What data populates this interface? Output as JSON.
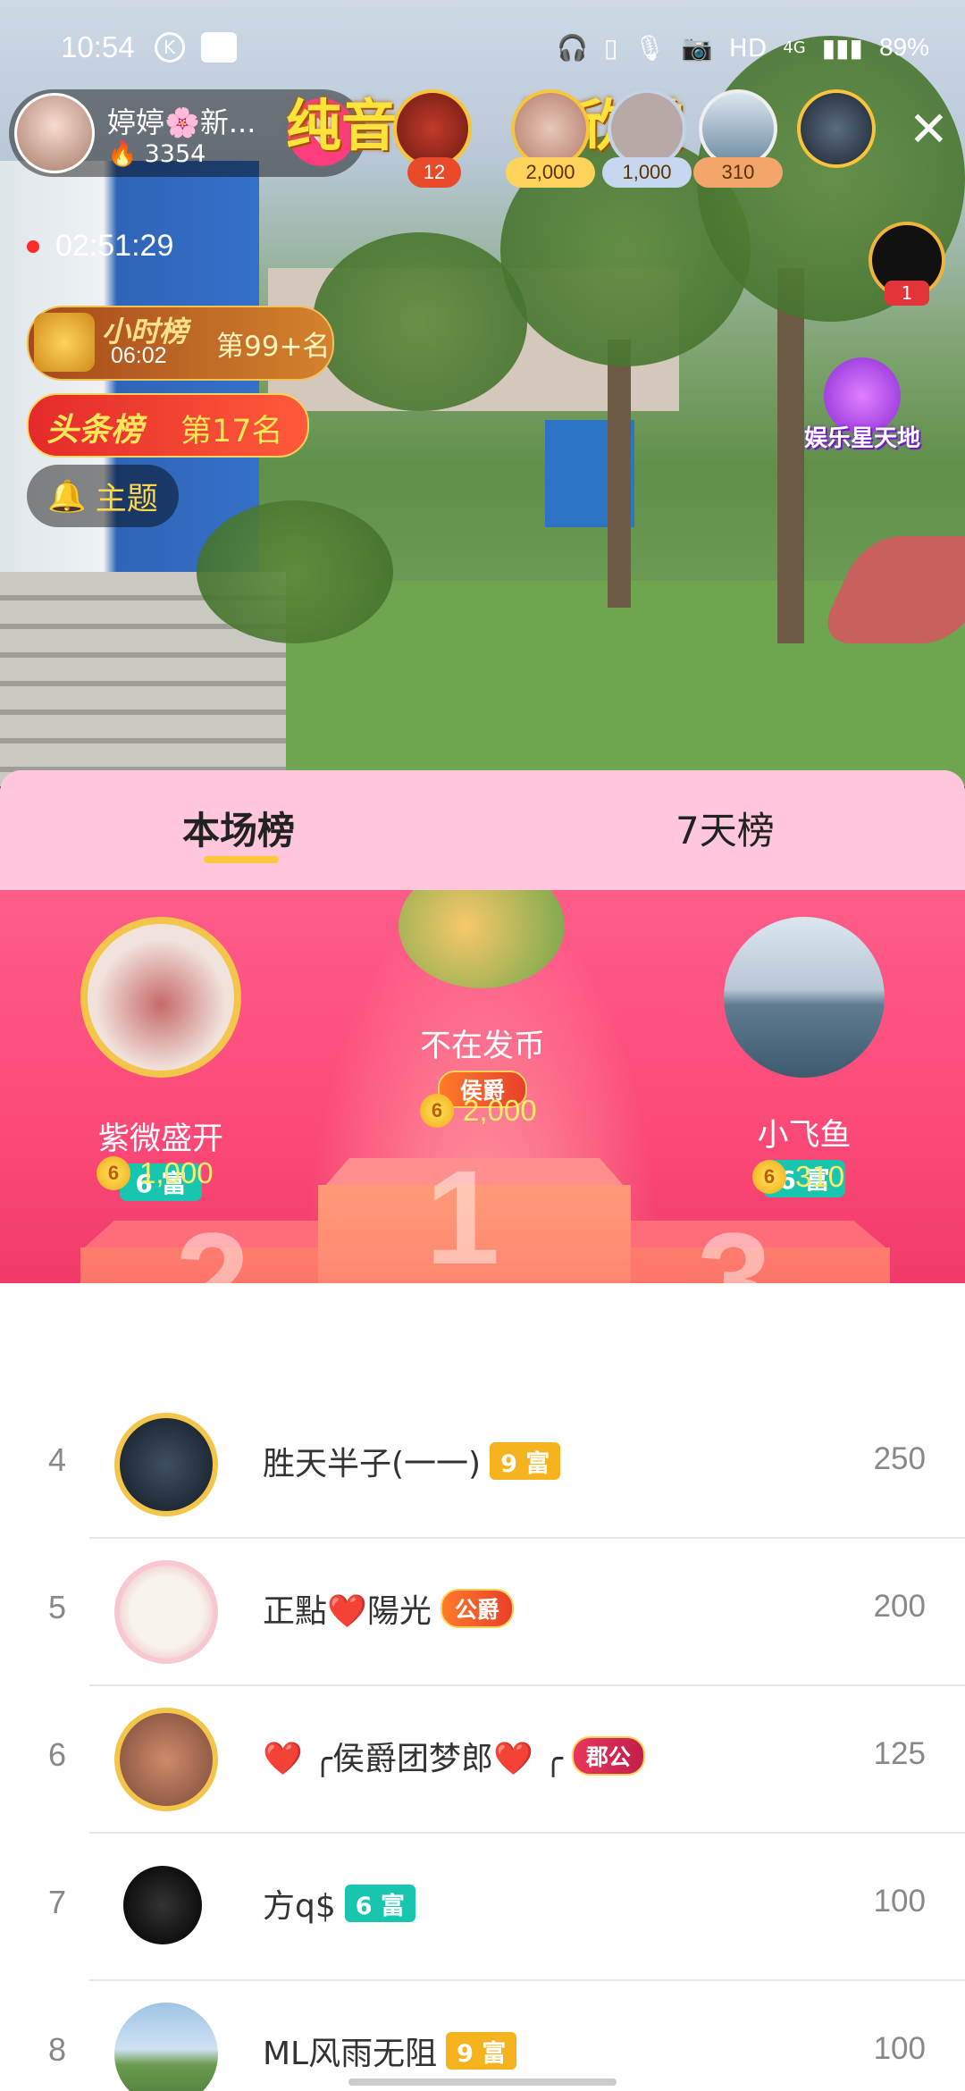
{
  "status_bar": {
    "time": "10:54",
    "indicators": "HD",
    "network": "4G",
    "battery": "89%"
  },
  "host": {
    "name": "婷婷🌸新...",
    "heat": "3354"
  },
  "banner": {
    "line1": "纯音乐",
    "line2": "请欣赏"
  },
  "gift_ranks": [
    {
      "value": "12"
    },
    {
      "value": "2,000"
    },
    {
      "value": "1,000"
    },
    {
      "value": "310"
    }
  ],
  "live": {
    "duration": "02:51:29"
  },
  "hour_rank": {
    "title": "小时榜",
    "countdown": "06:02",
    "position": "第99+名"
  },
  "head_rank": {
    "title": "头条榜",
    "position": "第17名"
  },
  "topic": {
    "label": "主题"
  },
  "right_side": {
    "avatar_tag": "1",
    "event_badge": "娱乐星天地"
  },
  "tabs": {
    "live": "本场榜",
    "week": "7天榜"
  },
  "podium": {
    "first": {
      "name": "不在发币",
      "badge": "侯爵",
      "coins": "2,000",
      "rank_number": "1"
    },
    "second": {
      "name": "紫微盛开",
      "level": "6 富",
      "coins": "1,000",
      "rank_number": "2"
    },
    "third": {
      "name": "小飞鱼",
      "level": "6 富",
      "coins": "310",
      "rank_number": "3"
    }
  },
  "list": [
    {
      "rank": "4",
      "name": "胜天半子(一一)",
      "level": "9 富",
      "level_color": "#f5b41e",
      "noble": "",
      "score": "250"
    },
    {
      "rank": "5",
      "name": "正點❤️陽光",
      "level": "",
      "level_color": "",
      "noble": "公爵",
      "score": "200"
    },
    {
      "rank": "6",
      "name": "❤️ ╭侯爵团梦郎❤️ ╭",
      "level": "",
      "level_color": "",
      "noble": "郡公",
      "score": "125"
    },
    {
      "rank": "7",
      "name": "方q$",
      "level": "6 富",
      "level_color": "#18c6b0",
      "noble": "",
      "score": "100"
    },
    {
      "rank": "8",
      "name": "ML风雨无阻",
      "level": "9 富",
      "level_color": "#f5b41e",
      "noble": "",
      "score": "100"
    }
  ]
}
